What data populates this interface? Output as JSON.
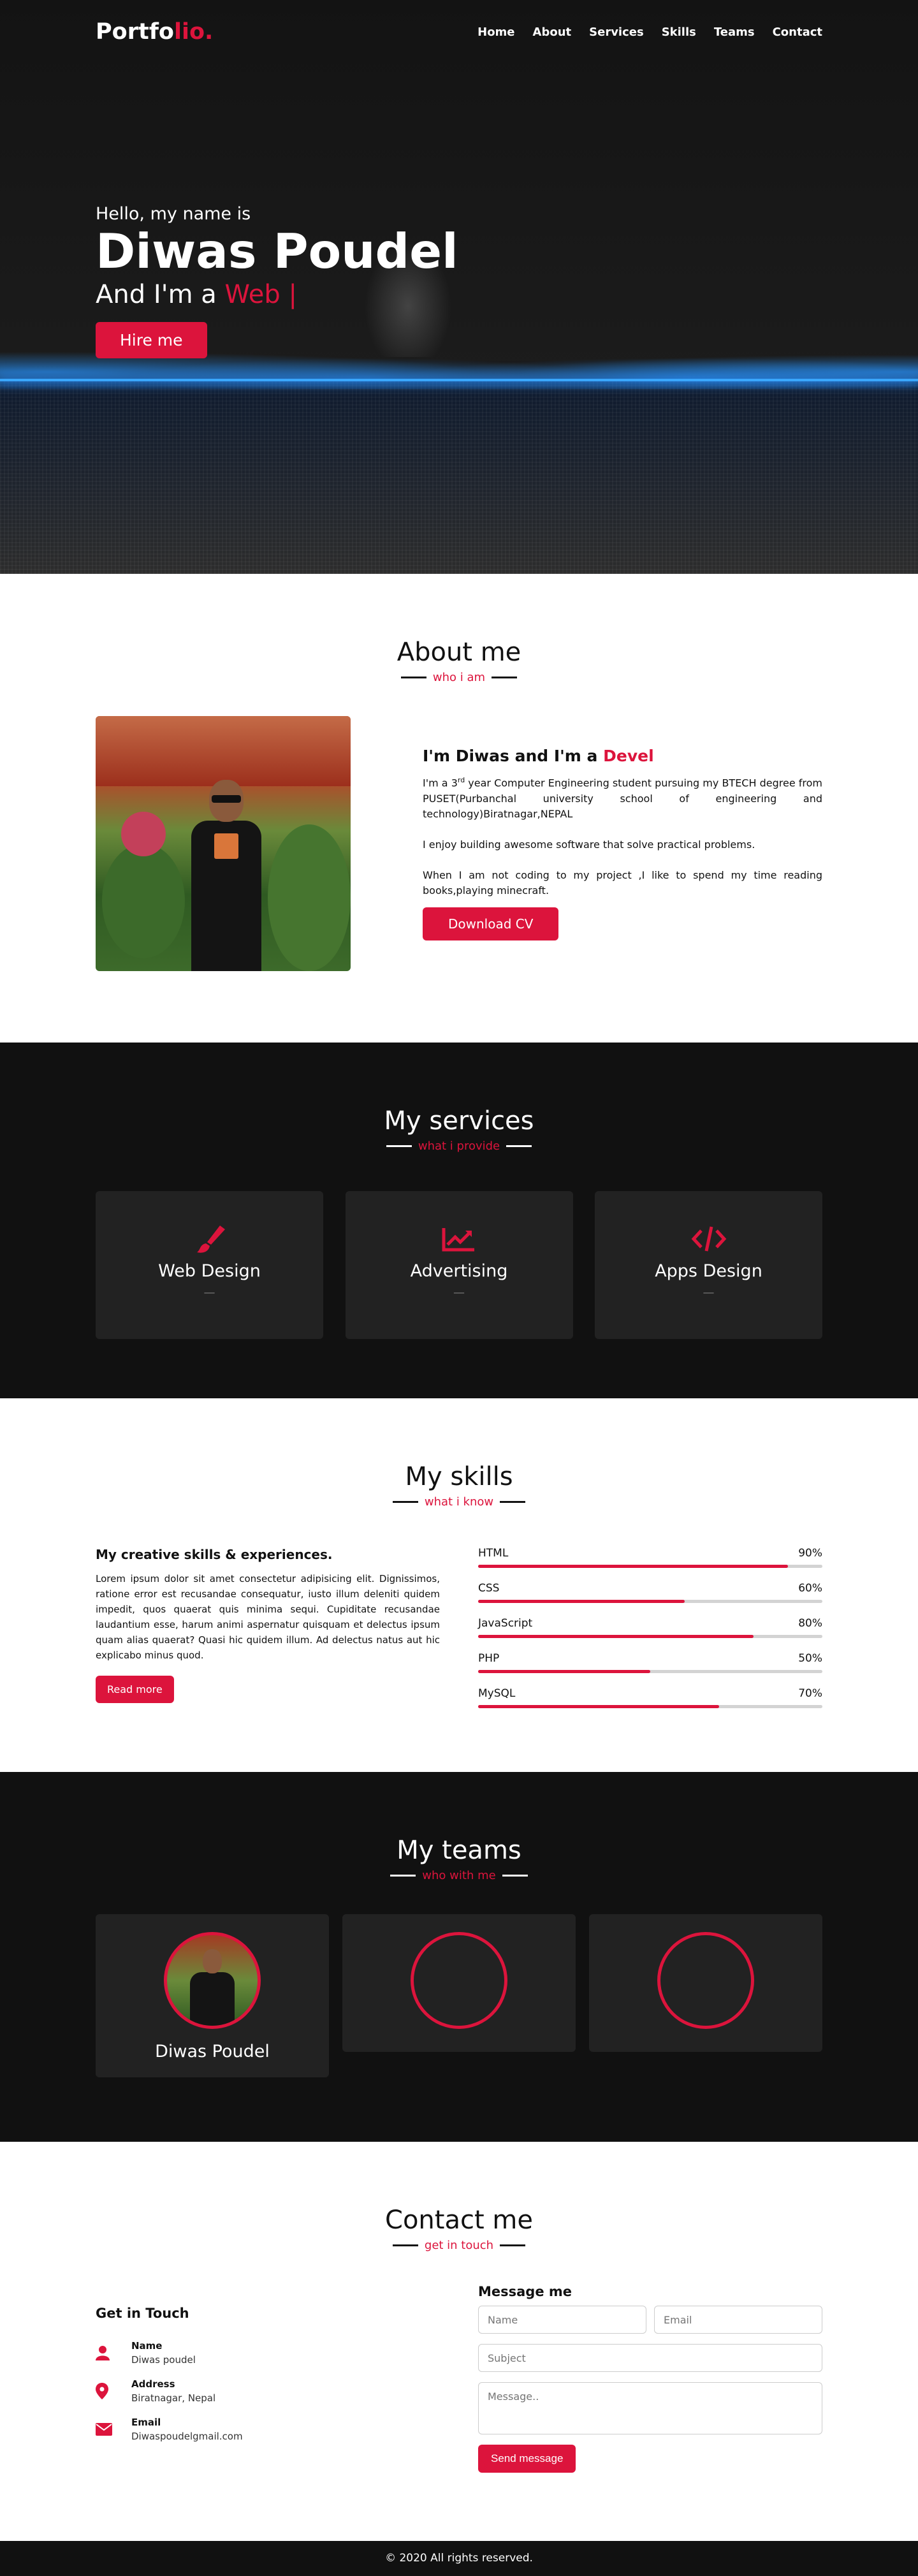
{
  "nav": {
    "logo_main": "Portfo",
    "logo_accent": "lio.",
    "items": [
      "Home",
      "About",
      "Services",
      "Skills",
      "Teams",
      "Contact"
    ]
  },
  "home": {
    "greeting": "Hello, my name is",
    "name": "Diwas Poudel",
    "role_prefix": "And I'm a",
    "role_typing": "Web |",
    "button": "Hire me"
  },
  "about": {
    "title": "About me",
    "subtitle": "who i am",
    "headline_prefix": "I'm Diwas and I'm a",
    "headline_typing": "Devel",
    "para1_a": "I'm a 3",
    "para1_sup": "rd",
    "para1_b": " year Computer Engineering student pursuing my BTECH degree from PUSET(Purbanchal university school of engineering and technology)Biratnagar,NEPAL",
    "para2": "I enjoy building awesome software that solve practical problems.",
    "para3": "When I am not coding to my project ,I like to spend my time reading books,playing minecraft.",
    "button": "Download CV"
  },
  "services": {
    "title": "My services",
    "subtitle": "what i provide",
    "cards": [
      {
        "name": "Web Design",
        "desc": "—",
        "icon": "paint-brush-icon"
      },
      {
        "name": "Advertising",
        "desc": "—",
        "icon": "chart-line-icon"
      },
      {
        "name": "Apps Design",
        "desc": "—",
        "icon": "code-icon"
      }
    ]
  },
  "skills": {
    "title": "My skills",
    "subtitle": "what i know",
    "heading": "My creative skills & experiences.",
    "paragraph": "Lorem ipsum dolor sit amet consectetur adipisicing elit. Dignissimos, ratione error est recusandae consequatur, iusto illum deleniti quidem impedit, quos quaerat quis minima sequi. Cupiditate recusandae laudantium esse, harum animi aspernatur quisquam et delectus ipsum quam alias quaerat? Quasi hic quidem illum. Ad delectus natus aut hic explicabo minus quod.",
    "button": "Read more",
    "bars": [
      {
        "name": "HTML",
        "percent": "90%",
        "value": 90
      },
      {
        "name": "CSS",
        "percent": "60%",
        "value": 60
      },
      {
        "name": "JavaScript",
        "percent": "80%",
        "value": 80
      },
      {
        "name": "PHP",
        "percent": "50%",
        "value": 50
      },
      {
        "name": "MySQL",
        "percent": "70%",
        "value": 70
      }
    ]
  },
  "teams": {
    "title": "My teams",
    "subtitle": "who with me",
    "members": [
      {
        "name": "Diwas Poudel"
      }
    ]
  },
  "contact": {
    "title": "Contact me",
    "subtitle": "get in touch",
    "left_heading": "Get in Touch",
    "info": [
      {
        "label": "Name",
        "value": "Diwas poudel",
        "icon": "user-icon"
      },
      {
        "label": "Address",
        "value": "Biratnagar, Nepal",
        "icon": "map-marker-icon"
      },
      {
        "label": "Email",
        "value": "Diwaspoudelgmail.com",
        "icon": "envelope-icon"
      }
    ],
    "right_heading": "Message me",
    "placeholders": {
      "name": "Name",
      "email": "Email",
      "subject": "Subject",
      "message": "Message.."
    },
    "button": "Send message"
  },
  "footer": {
    "text": "© 2020 All rights reserved."
  },
  "colors": {
    "accent": "#dc143c",
    "dark": "#111111",
    "card": "#222222"
  }
}
